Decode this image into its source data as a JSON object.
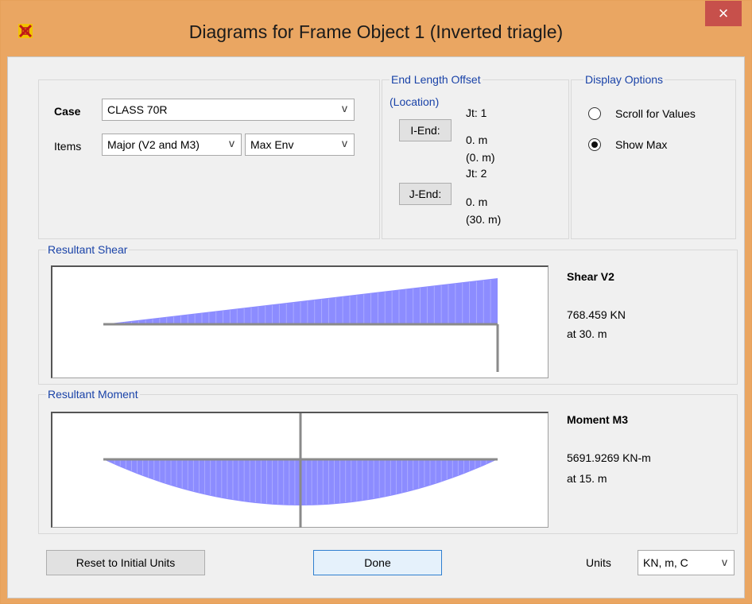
{
  "window": {
    "title": "Diagrams for Frame Object 1  (Inverted triagle)",
    "close_glyph": "×",
    "app_icon": "sap2000-app-icon"
  },
  "case": {
    "label": "Case",
    "value": "CLASS 70R"
  },
  "items": {
    "label": "Items",
    "value": "Major (V2 and M3)",
    "envelope": "Max Env"
  },
  "end_offset": {
    "group_label_1": "End Length Offset",
    "group_label_2": "(Location)",
    "i_end": {
      "button": "I-End:",
      "jt": "Jt:  1",
      "offset": "0. m",
      "location": "(0. m)"
    },
    "j_end": {
      "button": "J-End:",
      "jt": "Jt:  2",
      "offset": "0. m",
      "location": "(30. m)"
    }
  },
  "display_options": {
    "label": "Display Options",
    "options": [
      {
        "label": "Scroll for Values",
        "selected": false
      },
      {
        "label": "Show Max",
        "selected": true
      }
    ]
  },
  "shear": {
    "group_label": "Resultant Shear",
    "title": "Shear V2",
    "value": "768.459 KN",
    "location": "at 30. m"
  },
  "moment": {
    "group_label": "Resultant Moment",
    "title": "Moment M3",
    "value": "5691.9269 KN-m",
    "location": "at 15. m"
  },
  "footer": {
    "reset_label": "Reset to Initial Units",
    "done_label": "Done",
    "units_label": "Units",
    "units_value": "KN, m, C"
  },
  "colors": {
    "diagram_fill": "#8c8cff",
    "diagram_grid": "#aaaaff",
    "axis": "#8a8a8a"
  },
  "chart_data": [
    {
      "type": "area",
      "name_shown": "Shear V2",
      "x": [
        0,
        30
      ],
      "y": [
        0,
        768.459
      ],
      "xlim": [
        0,
        30
      ],
      "note_shape": "linear"
    },
    {
      "type": "area",
      "name_shown": "Moment M3",
      "x": [
        0,
        15,
        30
      ],
      "y": [
        0,
        5691.9269,
        0
      ],
      "xlim": [
        0,
        30
      ],
      "note_shape": "parabolic"
    }
  ]
}
